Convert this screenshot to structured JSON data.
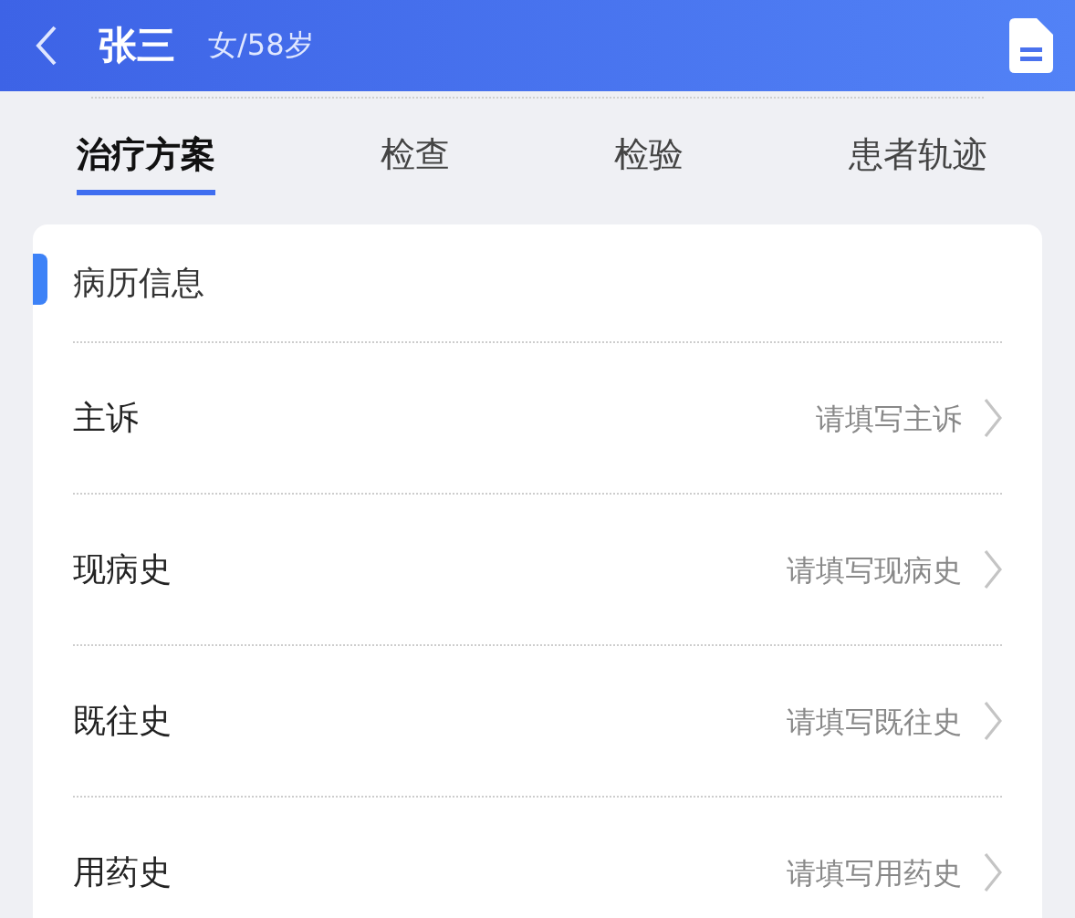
{
  "header": {
    "name": "张三",
    "info": "女/58岁"
  },
  "tabs": [
    {
      "label": "治疗方案",
      "selected": true
    },
    {
      "label": "检查",
      "selected": false
    },
    {
      "label": "检验",
      "selected": false
    },
    {
      "label": "患者轨迹",
      "selected": false
    }
  ],
  "section": {
    "title": "病历信息"
  },
  "rows": [
    {
      "label": "主诉",
      "placeholder": "请填写主诉"
    },
    {
      "label": "现病史",
      "placeholder": "请填写现病史"
    },
    {
      "label": "既往史",
      "placeholder": "请填写既往史"
    },
    {
      "label": "用药史",
      "placeholder": "请填写用药史"
    }
  ]
}
